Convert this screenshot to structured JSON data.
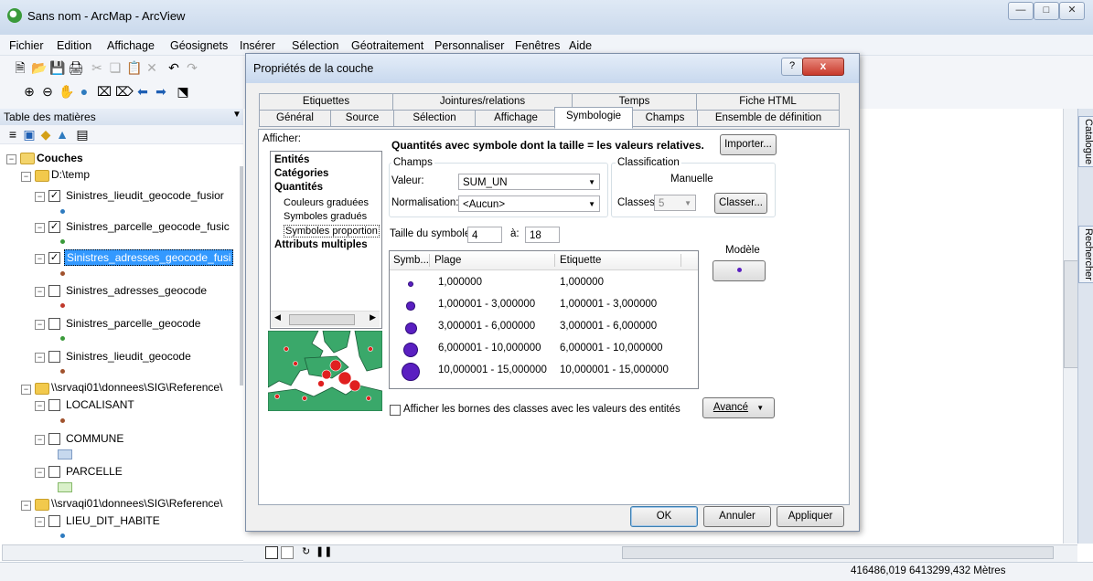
{
  "window": {
    "title": "Sans nom - ArcMap - ArcView"
  },
  "menu": [
    "Fichier",
    "Edition",
    "Affichage",
    "Géosignets",
    "Insérer",
    "Sélection",
    "Géotraitement",
    "Personnaliser",
    "Fenêtres",
    "Aide"
  ],
  "toc": {
    "title": "Table des matières",
    "root": "Couches",
    "folder1": "D:\\temp",
    "layers": [
      {
        "name": "Sinistres_lieudit_geocode_fusior",
        "checked": "✓",
        "dot": "#2e7bbf"
      },
      {
        "name": "Sinistres_parcelle_geocode_fusic",
        "checked": "✓",
        "dot": "#3a9a3a"
      },
      {
        "name": "Sinistres_adresses_geocode_fusi",
        "checked": "✓",
        "dot": "#a0522d"
      },
      {
        "name": "Sinistres_adresses_geocode",
        "checked": "",
        "dot": "#c0392b"
      },
      {
        "name": "Sinistres_parcelle_geocode",
        "checked": "",
        "dot": "#3a9a3a"
      },
      {
        "name": "Sinistres_lieudit_geocode",
        "checked": "",
        "dot": "#a0522d"
      }
    ],
    "folder2": "\\\\srvaqi01\\donnees\\SIG\\Reference\\",
    "layers2": [
      {
        "name": "LOCALISANT",
        "checked": ""
      },
      {
        "name": "COMMUNE",
        "checked": ""
      },
      {
        "name": "PARCELLE",
        "checked": ""
      }
    ],
    "folder3": "\\\\srvaqi01\\donnees\\SIG\\Reference\\",
    "layers3": [
      {
        "name": "LIEU_DIT_HABITE",
        "checked": ""
      }
    ]
  },
  "side_tabs": [
    "Catalogue",
    "Rechercher"
  ],
  "status": {
    "coords": "416486,019  6413299,432 Mètres"
  },
  "dialog": {
    "title": "Propriétés de la couche",
    "help": "?",
    "close": "x",
    "tabs_row1": [
      "Etiquettes",
      "Jointures/relations",
      "Temps",
      "Fiche HTML"
    ],
    "tabs_row2": [
      "Général",
      "Source",
      "Sélection",
      "Affichage",
      "Symbologie",
      "Champs",
      "Ensemble de définition"
    ],
    "active_tab": "Symbologie",
    "afficher_label": "Afficher:",
    "tree": {
      "entites": "Entités",
      "categories": "Catégories",
      "quantites": "Quantités",
      "sub": [
        "Couleurs graduées",
        "Symboles gradués",
        "Symboles proportion"
      ],
      "attributs": "Attributs multiples"
    },
    "header_text": "Quantités avec symbole dont la taille = les valeurs relatives.",
    "import_btn": "Importer...",
    "champs": {
      "label": "Champs",
      "valeur_label": "Valeur:",
      "valeur": "SUM_UN",
      "normalisation_label": "Normalisation:",
      "normalisation": "<Aucun>"
    },
    "classification": {
      "label": "Classification",
      "method": "Manuelle",
      "classes_label": "Classes:",
      "classes": "5",
      "classer_btn": "Classer..."
    },
    "taille": {
      "label": "Taille du symbole:",
      "from": "4",
      "to_label": "à:",
      "to": "18"
    },
    "modele_label": "Modèle",
    "grid": {
      "headers": [
        "Symb...",
        "Plage",
        "Etiquette"
      ],
      "rows": [
        {
          "plage": "1,000000",
          "etiquette": "1,000000",
          "size": 4
        },
        {
          "plage": "1,000001 - 3,000000",
          "etiquette": "1,000001 - 3,000000",
          "size": 7.5
        },
        {
          "plage": "3,000001 - 6,000000",
          "etiquette": "3,000001 - 6,000000",
          "size": 11
        },
        {
          "plage": "6,000001 - 10,000000",
          "etiquette": "6,000001 - 10,000000",
          "size": 14.5
        },
        {
          "plage": "10,000001 - 15,000000",
          "etiquette": "10,000001 - 15,000000",
          "size": 18
        }
      ]
    },
    "checkbox_label": "Afficher les bornes des classes avec les valeurs des entités",
    "avance_btn": "Avancé",
    "ok_btn": "OK",
    "annuler_btn": "Annuler",
    "appliquer_btn": "Appliquer"
  },
  "colors": {
    "symbol": "#5a1fc1",
    "selection": "#3399ff",
    "map_land": "#3aa86a",
    "map_dot": "#e02020"
  }
}
